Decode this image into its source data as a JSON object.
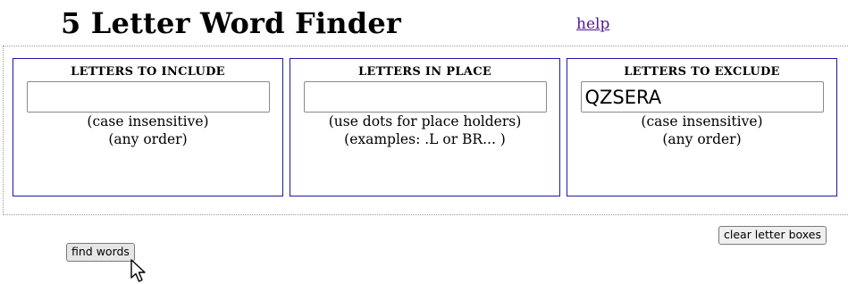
{
  "header": {
    "title": "5 Letter Word Finder",
    "help_label": "help"
  },
  "panels": {
    "include": {
      "heading": "LETTERS TO INCLUDE",
      "value": "",
      "note1": "(case insensitive)",
      "note2": "(any order)"
    },
    "in_place": {
      "heading": "LETTERS IN PLACE",
      "value": "",
      "note1": "(use dots for place holders)",
      "note2": "(examples: .L or BR... )"
    },
    "exclude": {
      "heading": "LETTERS TO EXCLUDE",
      "value": "QZSERA",
      "note1": "(case insensitive)",
      "note2": "(any order)"
    }
  },
  "actions": {
    "clear_label": "clear letter boxes",
    "find_label": "find words"
  },
  "colors": {
    "panel_border": "#1a1aa8",
    "link": "#551a8b"
  },
  "icons": {
    "cursor": "mouse-pointer-icon"
  }
}
